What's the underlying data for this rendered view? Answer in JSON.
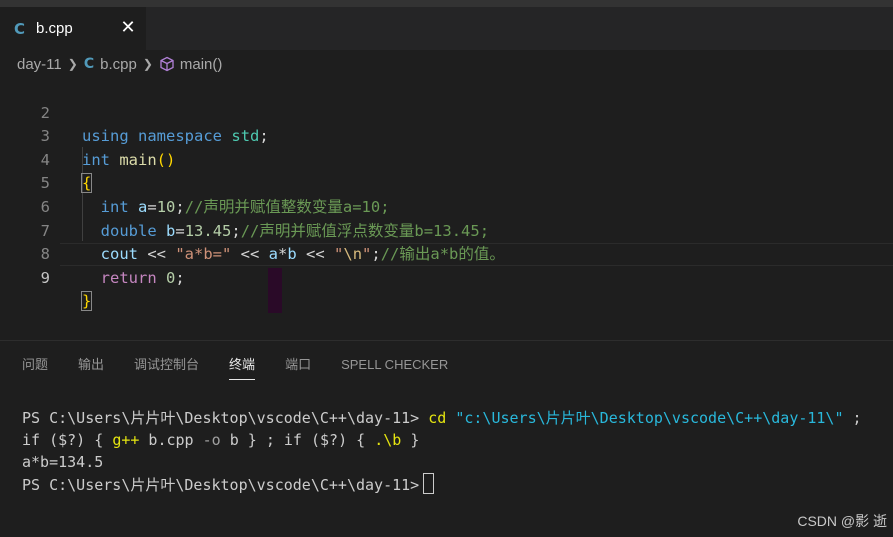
{
  "tab": {
    "icon": "cpp-file-icon",
    "title": "b.cpp",
    "close": "✕"
  },
  "breadcrumb": {
    "folder": "day-11",
    "file": "b.cpp",
    "symbol": "main()"
  },
  "editor": {
    "line_numbers": [
      "2",
      "3",
      "4",
      "5",
      "6",
      "7",
      "8",
      "9"
    ],
    "active_line": "9",
    "lines": {
      "l2": {
        "using": "using",
        "namespace": "namespace",
        "std": "std",
        "semi": ";"
      },
      "l3": {
        "int": "int",
        "main": "main",
        "parens": "()"
      },
      "l4": {
        "brace": "{"
      },
      "l5": {
        "indent": "  ",
        "int": "int",
        "a": "a",
        "eq": "=",
        "num": "10",
        "semi": ";",
        "comment": "//声明并赋值整数变量a=10;"
      },
      "l6": {
        "indent": "  ",
        "double": "double",
        "b": "b",
        "eq": "=",
        "num": "13.45",
        "semi": ";",
        "comment": "//声明并赋值浮点数变量b=13.45;"
      },
      "l7": {
        "indent": "  ",
        "cout": "cout",
        "op1": " << ",
        "str1": "\"a*b=\"",
        "op2": " << ",
        "a": "a",
        "mul": "*",
        "b": "b",
        "op3": " << ",
        "q1": "\"",
        "esc": "\\n",
        "q2": "\"",
        "semi": ";",
        "comment": "//输出a*b的值。"
      },
      "l8": {
        "indent": "  ",
        "return": "return",
        "num": "0",
        "semi": ";"
      },
      "l9": {
        "brace": "}"
      }
    }
  },
  "panel": {
    "tabs": [
      "问题",
      "输出",
      "调试控制台",
      "终端",
      "端口",
      "SPELL CHECKER"
    ],
    "active_tab": "终端"
  },
  "terminal": {
    "line1_prompt": "PS C:\\Users\\片片叶\\Desktop\\vscode\\C++\\day-11> ",
    "line1_cmd": "cd",
    "line1_path": "\"c:\\Users\\片片叶\\Desktop\\vscode\\C++\\day-11\\\"",
    "line1_end": " ;",
    "line2_a": "if ($?) { ",
    "line2_gpp": "g++",
    "line2_b": " b.cpp ",
    "line2_o": "-o",
    "line2_c": " b } ; if ($?) { ",
    "line2_run": ".\\b",
    "line2_d": " }",
    "line3": "a*b=134.5",
    "line4_prompt": "PS C:\\Users\\片片叶\\Desktop\\vscode\\C++\\day-11>"
  },
  "watermark": "CSDN @影 逝"
}
